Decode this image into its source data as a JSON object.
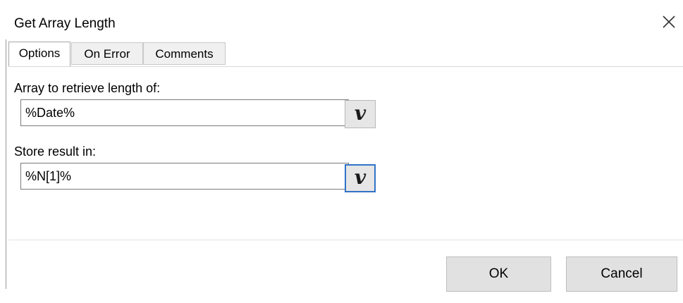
{
  "dialog": {
    "title": "Get Array Length",
    "close_icon": "close-icon"
  },
  "tabs": [
    {
      "label": "Options",
      "active": true
    },
    {
      "label": "On Error",
      "active": false
    },
    {
      "label": "Comments",
      "active": false
    }
  ],
  "options": {
    "array_label": "Array to retrieve length of:",
    "array_value": "%Date%",
    "result_label": "Store result in:",
    "result_value": "%N[1]%",
    "variable_button_glyph": "v"
  },
  "buttons": {
    "ok": "OK",
    "cancel": "Cancel"
  },
  "colors": {
    "focus_accent": "#2f73c7"
  }
}
